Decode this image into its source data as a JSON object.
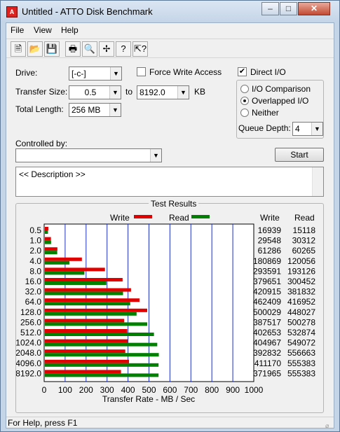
{
  "window": {
    "title": "Untitled - ATTO Disk Benchmark"
  },
  "menu": {
    "items": [
      "File",
      "View",
      "Help"
    ]
  },
  "toolbar": {
    "icons": [
      "new-icon",
      "open-icon",
      "save-icon",
      "print-icon",
      "print-preview-icon",
      "move-icon",
      "help-icon",
      "context-help-icon"
    ]
  },
  "form": {
    "drive_label": "Drive:",
    "drive_value": "[-c-]",
    "force_write_label": "Force Write Access",
    "direct_io_label": "Direct I/O",
    "direct_io_checked": true,
    "transfer_size_label": "Transfer Size:",
    "transfer_from": "0.5",
    "transfer_to_label": "to",
    "transfer_to": "8192.0",
    "transfer_unit": "KB",
    "total_length_label": "Total Length:",
    "total_length_value": "256 MB",
    "io_comparison_label": "I/O Comparison",
    "overlapped_io_label": "Overlapped I/O",
    "neither_label": "Neither",
    "selected_mode": "Overlapped I/O",
    "queue_depth_label": "Queue Depth:",
    "queue_depth_value": "4",
    "controlled_by_label": "Controlled by:",
    "controlled_by_value": "",
    "start_label": "Start",
    "description": "<< Description >>"
  },
  "results": {
    "title": "Test Results",
    "write_legend": "Write",
    "read_legend": "Read",
    "write_col": "Write",
    "read_col": "Read",
    "rows": [
      {
        "size": "0.5",
        "write": "16939",
        "read": "15118"
      },
      {
        "size": "1.0",
        "write": "29548",
        "read": "30312"
      },
      {
        "size": "2.0",
        "write": "61286",
        "read": "60265"
      },
      {
        "size": "4.0",
        "write": "180869",
        "read": "120056"
      },
      {
        "size": "8.0",
        "write": "293591",
        "read": "193126"
      },
      {
        "size": "16.0",
        "write": "379651",
        "read": "300452"
      },
      {
        "size": "32.0",
        "write": "420915",
        "read": "381832"
      },
      {
        "size": "64.0",
        "write": "462409",
        "read": "416952"
      },
      {
        "size": "128.0",
        "write": "500029",
        "read": "448027"
      },
      {
        "size": "256.0",
        "write": "387517",
        "read": "500278"
      },
      {
        "size": "512.0",
        "write": "402653",
        "read": "532874"
      },
      {
        "size": "1024.0",
        "write": "404967",
        "read": "549072"
      },
      {
        "size": "2048.0",
        "write": "392832",
        "read": "556663"
      },
      {
        "size": "4096.0",
        "write": "411170",
        "read": "555383"
      },
      {
        "size": "8192.0",
        "write": "371965",
        "read": "555383"
      }
    ],
    "axis_ticks": [
      "0",
      "100",
      "200",
      "300",
      "400",
      "500",
      "600",
      "700",
      "800",
      "900",
      "1000"
    ],
    "axis_label": "Transfer Rate - MB / Sec",
    "write_color": "#e00000",
    "read_color": "#008000",
    "grid_color": "#1d2fbf"
  },
  "chart_data": {
    "type": "bar",
    "xlabel": "Transfer Rate - MB / Sec",
    "xlim": [
      0,
      1000
    ],
    "categories": [
      "0.5",
      "1.0",
      "2.0",
      "4.0",
      "8.0",
      "16.0",
      "32.0",
      "64.0",
      "128.0",
      "256.0",
      "512.0",
      "1024.0",
      "2048.0",
      "4096.0",
      "8192.0"
    ],
    "series": [
      {
        "name": "Write",
        "values": [
          16.5,
          28.9,
          59.8,
          176.6,
          286.7,
          370.8,
          411.0,
          451.6,
          488.3,
          378.4,
          393.2,
          395.5,
          383.6,
          401.5,
          363.2
        ]
      },
      {
        "name": "Read",
        "values": [
          14.8,
          29.6,
          58.9,
          117.2,
          188.6,
          293.4,
          372.9,
          407.2,
          437.5,
          488.6,
          520.4,
          536.2,
          543.6,
          542.4,
          542.4
        ]
      }
    ]
  },
  "status": {
    "text": "For Help, press F1"
  }
}
